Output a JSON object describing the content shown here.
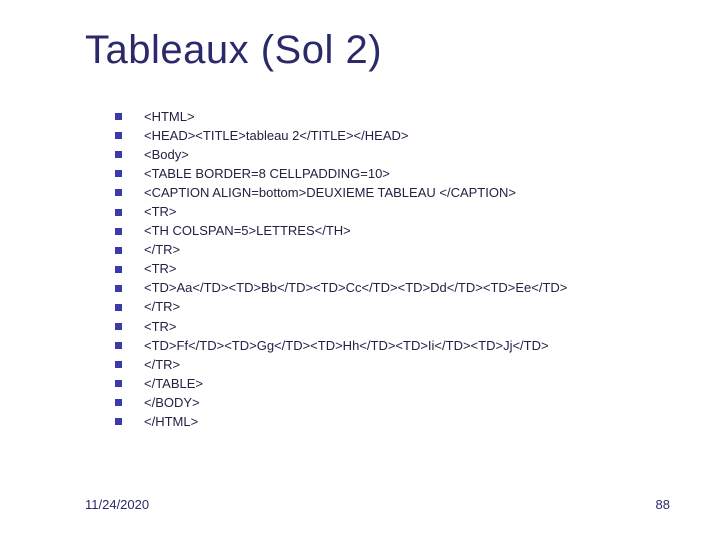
{
  "title": "Tableaux (Sol 2)",
  "lines": [
    "<HTML>",
    "<HEAD><TITLE>tableau 2</TITLE></HEAD>",
    "<Body>",
    "<TABLE BORDER=8 CELLPADDING=10>",
    "<CAPTION ALIGN=bottom>DEUXIEME TABLEAU </CAPTION>",
    "<TR>",
    "<TH COLSPAN=5>LETTRES</TH>",
    "</TR>",
    "<TR>",
    "<TD>Aa</TD><TD>Bb</TD><TD>Cc</TD><TD>Dd</TD><TD>Ee</TD>",
    "</TR>",
    "<TR>",
    "<TD>Ff</TD><TD>Gg</TD><TD>Hh</TD><TD>Ii</TD><TD>Jj</TD>",
    "</TR>",
    "</TABLE>",
    "</BODY>",
    "</HTML>"
  ],
  "footer": {
    "date": "11/24/2020",
    "page": "88"
  }
}
